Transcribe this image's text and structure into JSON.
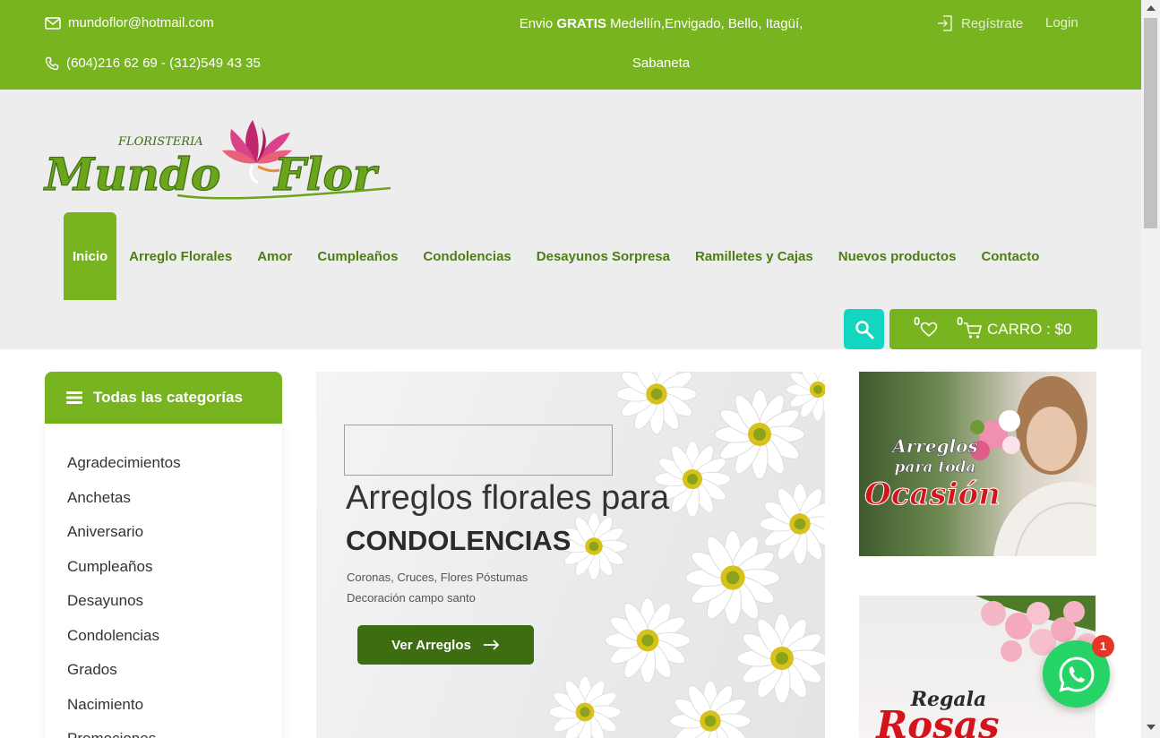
{
  "topbar": {
    "email": "mundoflor@hotmail.com",
    "phone": "(604)216 62 69 - (312)549 43 35",
    "shipping_prefix": "Envio",
    "shipping_bold": "GRATIS",
    "shipping_rest": "Medellín,Envigado, Bello, Itagüí, Sabaneta",
    "register_label": "Regístrate",
    "login_label": "Login"
  },
  "logo": {
    "small_text": "FLORISTERIA",
    "main_text_1": "Mundo",
    "main_text_2": "Flor"
  },
  "nav": {
    "items": [
      {
        "label": "Inicio",
        "active": true
      },
      {
        "label": "Arreglo Florales"
      },
      {
        "label": "Amor"
      },
      {
        "label": "Cumpleaños"
      },
      {
        "label": "Condolencias"
      },
      {
        "label": "Desayunos Sorpresa"
      },
      {
        "label": "Ramilletes y Cajas"
      },
      {
        "label": "Nuevos productos"
      },
      {
        "label": "Contacto"
      }
    ]
  },
  "cart": {
    "wishlist_count": "0",
    "cart_count": "0",
    "label": "CARRO : $0"
  },
  "categories": {
    "title": "Todas las categorías",
    "items": [
      "Agradecimientos",
      "Anchetas",
      "Aniversario",
      "Cumpleaños",
      "Desayunos",
      "Condolencias",
      "Grados",
      "Nacimiento",
      "Promociones"
    ]
  },
  "hero": {
    "line1": "Arreglos florales para",
    "line2": "CONDOLENCIAS",
    "sub1": "Coronas, Cruces, Flores Póstumas",
    "sub2": "Decoración campo santo",
    "button_label": "Ver Arreglos"
  },
  "promo1": {
    "line1": "Arreglos",
    "line2": "para toda",
    "line3": "Ocasión"
  },
  "promo2": {
    "line1": "Regala",
    "line2": "Rosas"
  },
  "whatsapp": {
    "badge": "1"
  },
  "colors": {
    "brand_green": "#77b41f",
    "dark_green": "#3d6d10",
    "nav_text": "#4e7d14",
    "search_teal": "#12d6c0",
    "badge_red": "#e53527",
    "whatsapp": "#25d366"
  }
}
